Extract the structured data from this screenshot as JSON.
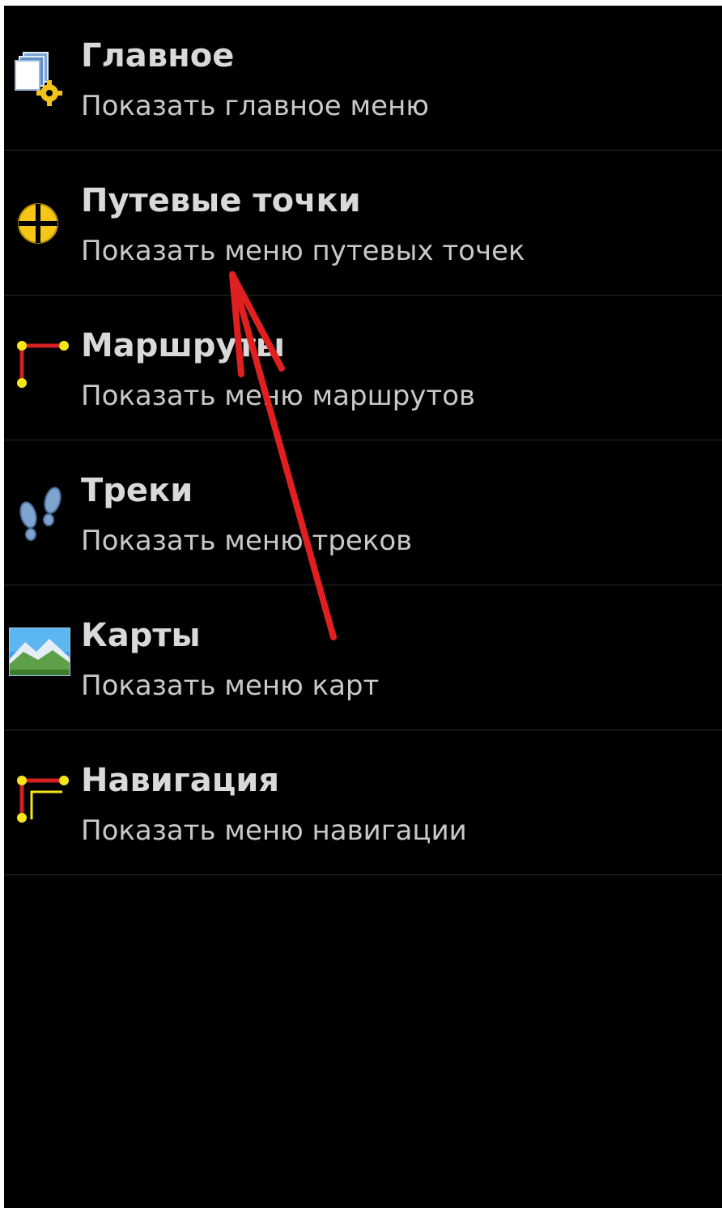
{
  "menu": {
    "items": [
      {
        "title": "Главное",
        "subtitle": "Показать главное меню",
        "icon": "main-menu-icon"
      },
      {
        "title": "Путевые точки",
        "subtitle": "Показать меню путевых точек",
        "icon": "waypoint-icon"
      },
      {
        "title": "Маршруты",
        "subtitle": "Показать меню маршрутов",
        "icon": "route-icon"
      },
      {
        "title": "Треки",
        "subtitle": "Показать меню треков",
        "icon": "footprints-icon"
      },
      {
        "title": "Карты",
        "subtitle": "Показать меню карт",
        "icon": "map-landscape-icon"
      },
      {
        "title": "Навигация",
        "subtitle": "Показать меню навигации",
        "icon": "navigation-icon"
      }
    ]
  },
  "colors": {
    "background": "#000000",
    "title": "#d9d9d9",
    "subtitle": "#c9c9c9",
    "divider": "#2a2a2a",
    "annotation_arrow": "#e02020"
  }
}
